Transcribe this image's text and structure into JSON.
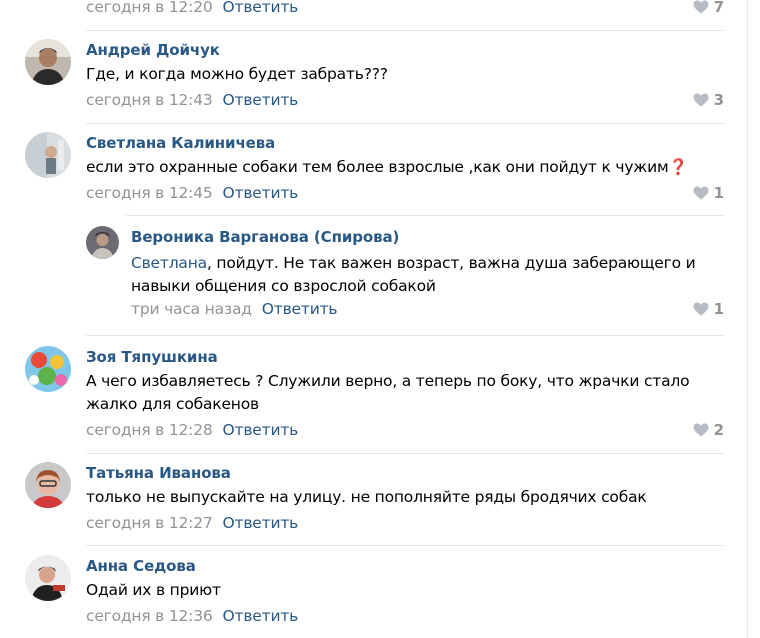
{
  "comments": [
    {
      "author": "",
      "text": "",
      "time": "сегодня в 12:20",
      "reply": "Ответить",
      "likes": "7"
    },
    {
      "author": "Андрей Дойчук",
      "text": "Где, и когда можно будет забрать???",
      "time": "сегодня в 12:43",
      "reply": "Ответить",
      "likes": "3"
    },
    {
      "author": "Светлана Калиничева",
      "text": "если это охранные собаки тем более взрослые ,как они пойдут к чужим❓",
      "time": "сегодня в 12:45",
      "reply": "Ответить",
      "likes": "1"
    },
    {
      "author": "Вероника Варганова (Спирова)",
      "mention": "Светлана",
      "text": ", пойдут. Не так важен возраст, важна душа заберающего и навыки общения со взрослой собакой",
      "time": "три часа назад",
      "reply": "Ответить",
      "likes": "1"
    },
    {
      "author": "Зоя Тяпушкина",
      "text": "А чего избавляетесь ? Служили верно, а теперь по боку, что жрачки стало жалко для собакенов",
      "time": "сегодня в 12:28",
      "reply": "Ответить",
      "likes": "2"
    },
    {
      "author": "Татьяна Иванова",
      "text": "только не выпускайте на улицу. не пополняйте ряды бродячих собак",
      "time": "сегодня в 12:27",
      "reply": "Ответить",
      "likes": ""
    },
    {
      "author": "Анна Седова",
      "text": "Одай их в приют",
      "time": "сегодня в 12:36",
      "reply": "Ответить",
      "likes": ""
    }
  ],
  "colors": {
    "link": "#2a5885",
    "meta": "#939393",
    "separator": "#e7e8ec"
  },
  "icons": {
    "like": "heart-icon"
  }
}
